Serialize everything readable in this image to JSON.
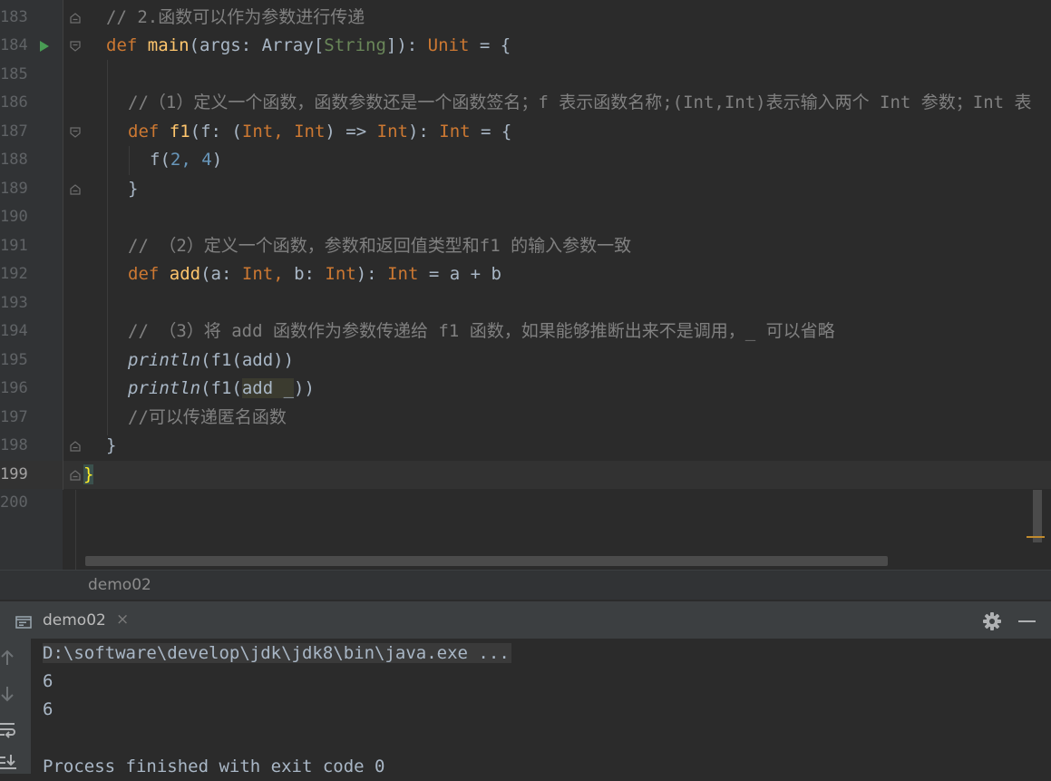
{
  "editor": {
    "line_numbers": [
      "183",
      "184",
      "185",
      "186",
      "187",
      "188",
      "189",
      "190",
      "191",
      "192",
      "193",
      "194",
      "195",
      "196",
      "197",
      "198",
      "199",
      "200"
    ],
    "current_line": "199",
    "lines": {
      "l183_comment": "// 2.函数可以作为参数进行传递",
      "l184_def": "def",
      "l184_name": "main",
      "l184_p1": "(args: Array[",
      "l184_string": "String",
      "l184_p2": "]): ",
      "l184_unit": "Unit",
      "l184_p3": " = {",
      "l186_comment": "//（1）定义一个函数，函数参数还是一个函数签名；f 表示函数名称;(Int,Int)表示输入两个 Int 参数；Int 表",
      "l187_def": "def",
      "l187_name": "f1",
      "l187_p1": "(f: (",
      "l187_int1": "Int,",
      "l187_sp": " ",
      "l187_int2": "Int",
      "l187_p2": ") => ",
      "l187_int3": "Int",
      "l187_p3": "): ",
      "l187_int4": "Int",
      "l187_p4": " = {",
      "l188_p1": "f(",
      "l188_n1": "2",
      "l188_p2": ", ",
      "l188_n2": "4",
      "l188_p3": ")",
      "l189_brace": "}",
      "l191_comment": "// （2）定义一个函数，参数和返回值类型和f1 的输入参数一致",
      "l192_def": "def",
      "l192_name": "add",
      "l192_p1": "(a: ",
      "l192_int1": "Int,",
      "l192_p2": " b: ",
      "l192_int2": "Int",
      "l192_p3": "): ",
      "l192_int3": "Int",
      "l192_p4": " = a + b",
      "l194_comment": "// （3）将 add 函数作为参数传递给 f1 函数，如果能够推断出来不是调用，_ 可以省略",
      "l195_fn": "println",
      "l195_rest": "(f1(add))",
      "l196_fn": "println",
      "l196_p1": "(f1(",
      "l196_hl": "add _",
      "l196_p2": "))",
      "l197_comment": "//可以传递匿名函数",
      "l198_brace": "}",
      "l199_brace": "}"
    }
  },
  "breadcrumb": {
    "label": "demo02"
  },
  "run_panel": {
    "tab_label": "demo02",
    "tab_close": "×",
    "icons": [
      "run-config-icon",
      "gear-icon",
      "minimize-icon",
      "up-arrow-icon",
      "down-arrow-icon",
      "soft-wrap-icon",
      "scroll-to-end-icon"
    ]
  },
  "console": {
    "command": "D:\\software\\develop\\jdk\\jdk8\\bin\\java.exe ...",
    "output_1": "6",
    "output_2": "6",
    "exit": "Process finished with exit code 0"
  },
  "colors": {
    "keyword": "#cc7832",
    "function": "#ffc66d",
    "comment": "#808080",
    "number": "#6897bb",
    "string_type": "#6a8759",
    "text": "#a9b7c6",
    "run_arrow": "#499c54"
  }
}
